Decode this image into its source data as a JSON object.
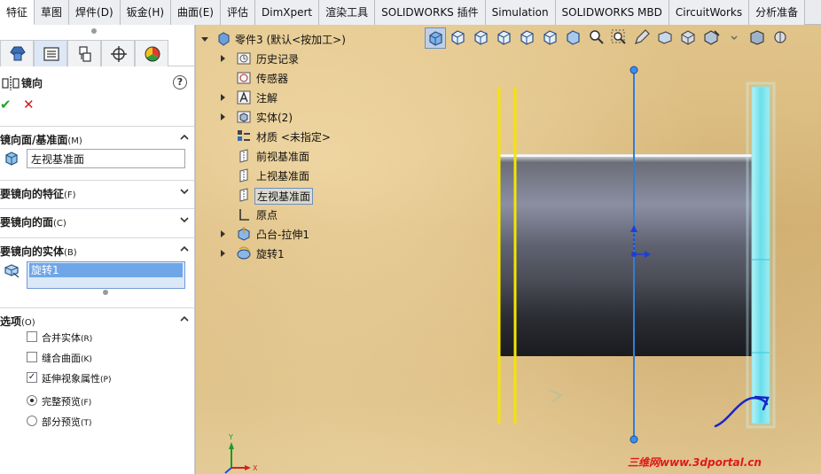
{
  "tabs": [
    "特征",
    "草图",
    "焊件(D)",
    "钣金(H)",
    "曲面(E)",
    "评估",
    "DimXpert",
    "渲染工具",
    "SOLIDWORKS 插件",
    "Simulation",
    "SOLIDWORKS MBD",
    "CircuitWorks",
    "分析准备"
  ],
  "panel": {
    "title": "镜向",
    "help": "?",
    "ok": "✔",
    "cancel": "✕",
    "sections": {
      "mirror_face": {
        "label": "镜向面/基准面",
        "suffix": "(M)",
        "value": "左视基准面"
      },
      "features": {
        "label": "要镜向的特征",
        "suffix": "(F)"
      },
      "faces": {
        "label": "要镜向的面",
        "suffix": "(C)"
      },
      "bodies": {
        "label": "要镜向的实体",
        "suffix": "(B)",
        "value": "旋转1"
      },
      "options": {
        "label": "选项",
        "suffix": "(O)"
      }
    },
    "options": [
      {
        "text": "合并实体",
        "suffix": "(R)",
        "type": "checkbox",
        "checked": false
      },
      {
        "text": "缝合曲面",
        "suffix": "(K)",
        "type": "checkbox",
        "checked": false
      },
      {
        "text": "延伸视象属性",
        "suffix": "(P)",
        "type": "checkbox",
        "checked": true
      },
      {
        "text": "完整预览",
        "suffix": "(F)",
        "type": "radio",
        "checked": true
      },
      {
        "text": "部分预览",
        "suffix": "(T)",
        "type": "radio",
        "checked": false
      }
    ]
  },
  "tree": {
    "root": "零件3 (默认<按加工>)",
    "items": [
      "历史记录",
      "传感器",
      "注解",
      "实体(2)",
      "材质 <未指定>",
      "前视基准面",
      "上视基准面",
      "左视基准面",
      "原点",
      "凸台-拉伸1",
      "旋转1"
    ]
  },
  "triad": {
    "y": "Y",
    "x": "X"
  },
  "watermark": "三维网www.3dportal.cn",
  "colors": {
    "preview_cyan": "#5fe3f5",
    "plane_yellow": "#f4e400",
    "axis_blue": "#2f7fd8",
    "body_gray": "#5d6068"
  }
}
